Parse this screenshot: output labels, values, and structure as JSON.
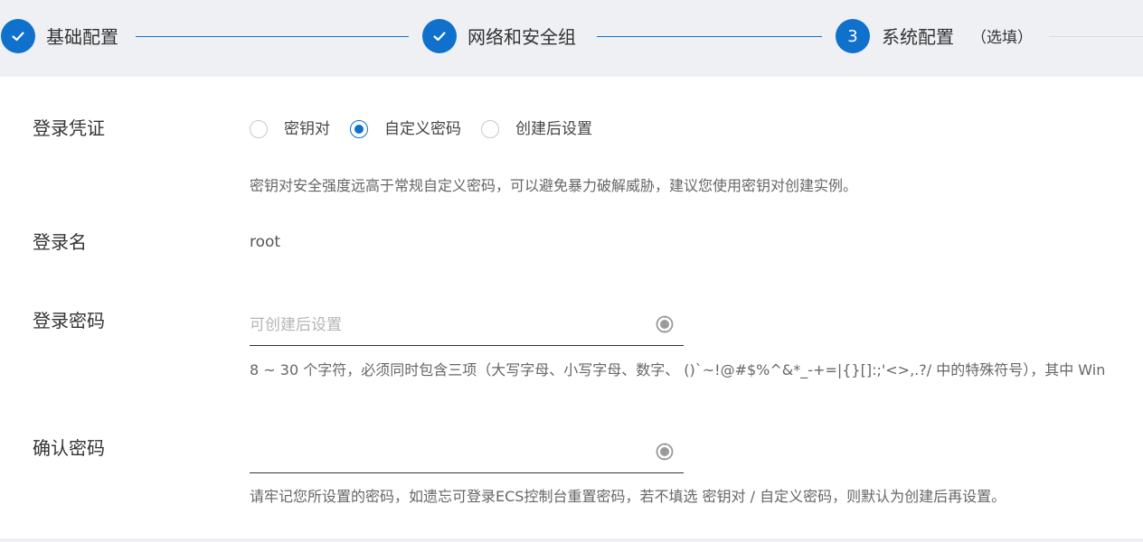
{
  "stepper": {
    "steps": [
      {
        "label": "基础配置",
        "status": "done"
      },
      {
        "label": "网络和安全组",
        "status": "done"
      },
      {
        "label": "系统配置",
        "number": "3",
        "sub": "（选填）",
        "status": "active"
      }
    ]
  },
  "form": {
    "login_credential": {
      "label": "登录凭证",
      "options": [
        "密钥对",
        "自定义密码",
        "创建后设置"
      ],
      "selected": "自定义密码",
      "hint": "密钥对安全强度远高于常规自定义密码，可以避免暴力破解威胁，建议您使用密钥对创建实例。"
    },
    "login_name": {
      "label": "登录名",
      "value": "root"
    },
    "login_password": {
      "label": "登录密码",
      "placeholder": "可创建后设置",
      "value": "",
      "hint": "8 ~ 30 个字符，必须同时包含三项（大写字母、小写字母、数字、 ()`~!@#$%^&*_-+=|{}[]:;'<>,.?/ 中的特殊符号），其中 Win"
    },
    "confirm_password": {
      "label": "确认密码",
      "placeholder": "",
      "value": "",
      "hint": "请牢记您所设置的密码，如遗忘可登录ECS控制台重置密码，若不填选 密钥对 / 自定义密码，则默认为创建后再设置。"
    }
  },
  "colors": {
    "accent": "#0f71cc",
    "stepper_bg": "#eff0f4"
  },
  "icons": {
    "step_done": "check-icon",
    "password_toggle": "refresh-icon"
  }
}
